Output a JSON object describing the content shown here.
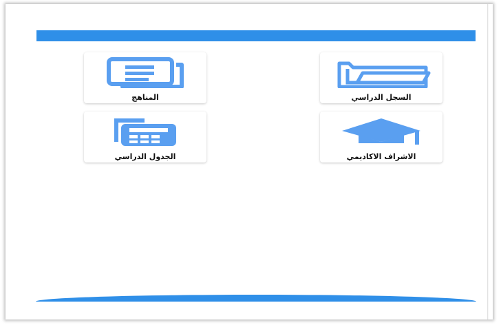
{
  "header": {
    "title": ""
  },
  "colors": {
    "primary": "#2f8fe8",
    "icon": "#5a9ff0"
  },
  "menu": {
    "items": [
      {
        "label": "السجل الدراسي",
        "icon": "folder-icon"
      },
      {
        "label": "المناهج",
        "icon": "document-icon"
      },
      {
        "label": "الاشراف الاكاديمي",
        "icon": "graduation-cap-icon"
      },
      {
        "label": "الجدول الدراسي",
        "icon": "calendar-icon"
      }
    ]
  }
}
